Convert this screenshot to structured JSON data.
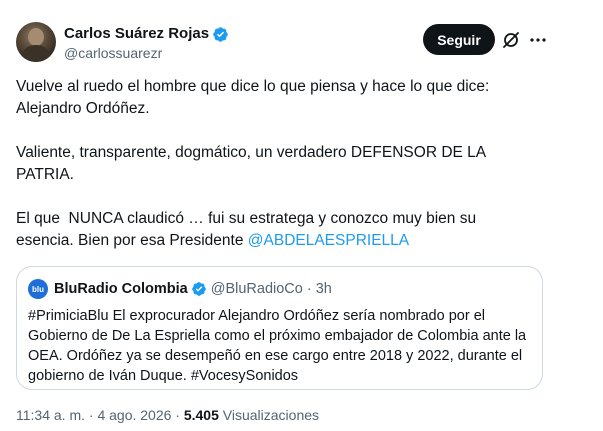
{
  "author": {
    "display_name": "Carlos Suárez Rojas",
    "handle": "@carlossuarezr",
    "verified": true
  },
  "actions": {
    "follow_label": "Seguir"
  },
  "tweet": {
    "paragraph_1": "Vuelve al ruedo el hombre que dice lo que piensa y hace lo que dice:\nAlejandro Ordóñez.",
    "paragraph_2": "Valiente, transparente, dogmático, un verdadero DEFENSOR DE LA\nPATRIA.",
    "paragraph_3_text": "El que  NUNCA claudicó … fui su estratega y conozco muy bien su\nesencia. Bien por esa Presidente ",
    "paragraph_3_mention": "@ABDELAESPRIELLA"
  },
  "quote": {
    "avatar_text": "blu",
    "display_name": "BluRadio Colombia",
    "handle": "@BluRadioCo",
    "separator": "·",
    "time": "3h",
    "text": "#PrimiciaBlu El exprocurador Alejandro Ordóñez sería nombrado por el Gobierno de De La Espriella como el próximo embajador de Colombia ante la OEA. Ordóñez ya se desempeñó en ese cargo entre 2018 y 2022, durante el gobierno de Iván Duque. #VocesySonidos"
  },
  "meta": {
    "timestamp": "11:34 a. m. · 4 ago. 2026 · ",
    "views_count": "5.405",
    "views_label": " Visualizaciones"
  },
  "colors": {
    "accent": "#1d9bf0",
    "text": "#0f1419",
    "muted": "#536471",
    "border": "#cfd9de"
  }
}
